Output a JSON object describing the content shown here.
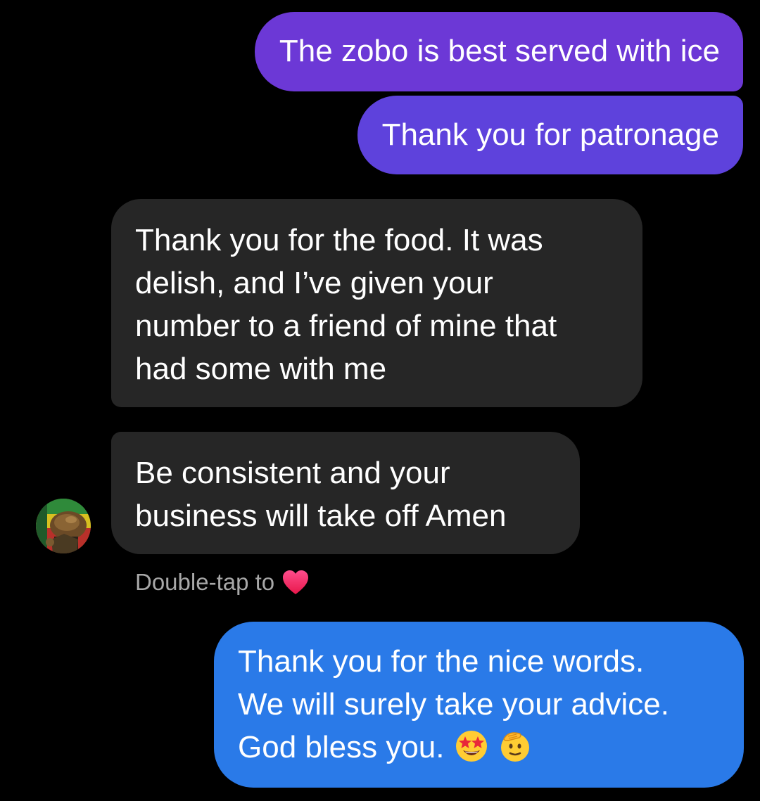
{
  "conversation": {
    "messages": [
      {
        "sender": "me",
        "text": "The zobo is best served with ice"
      },
      {
        "sender": "me",
        "text": "Thank you for patronage"
      },
      {
        "sender": "contact",
        "lines": [
          "Thank you for the food. It was",
          "delish, and I’ve given your",
          "number to a friend of mine that",
          "had some with me"
        ]
      },
      {
        "sender": "contact",
        "lines": [
          "Be consistent and your",
          "business will take off Amen"
        ]
      },
      {
        "sender": "me",
        "lines": [
          "Thank you for the nice words.",
          "We will surely take your advice.",
          "God bless you."
        ],
        "emojis": [
          "star-struck-emoji",
          "saluting-face-emoji"
        ]
      }
    ],
    "reaction_hint": {
      "text": "Double-tap to",
      "icon": "heart-icon"
    }
  },
  "colors": {
    "outgoing_purple": "#6c38d6",
    "outgoing_indigo": "#5e42dc",
    "outgoing_blue": "#2a7ae8",
    "incoming_gray": "#262626",
    "background": "#000000"
  }
}
